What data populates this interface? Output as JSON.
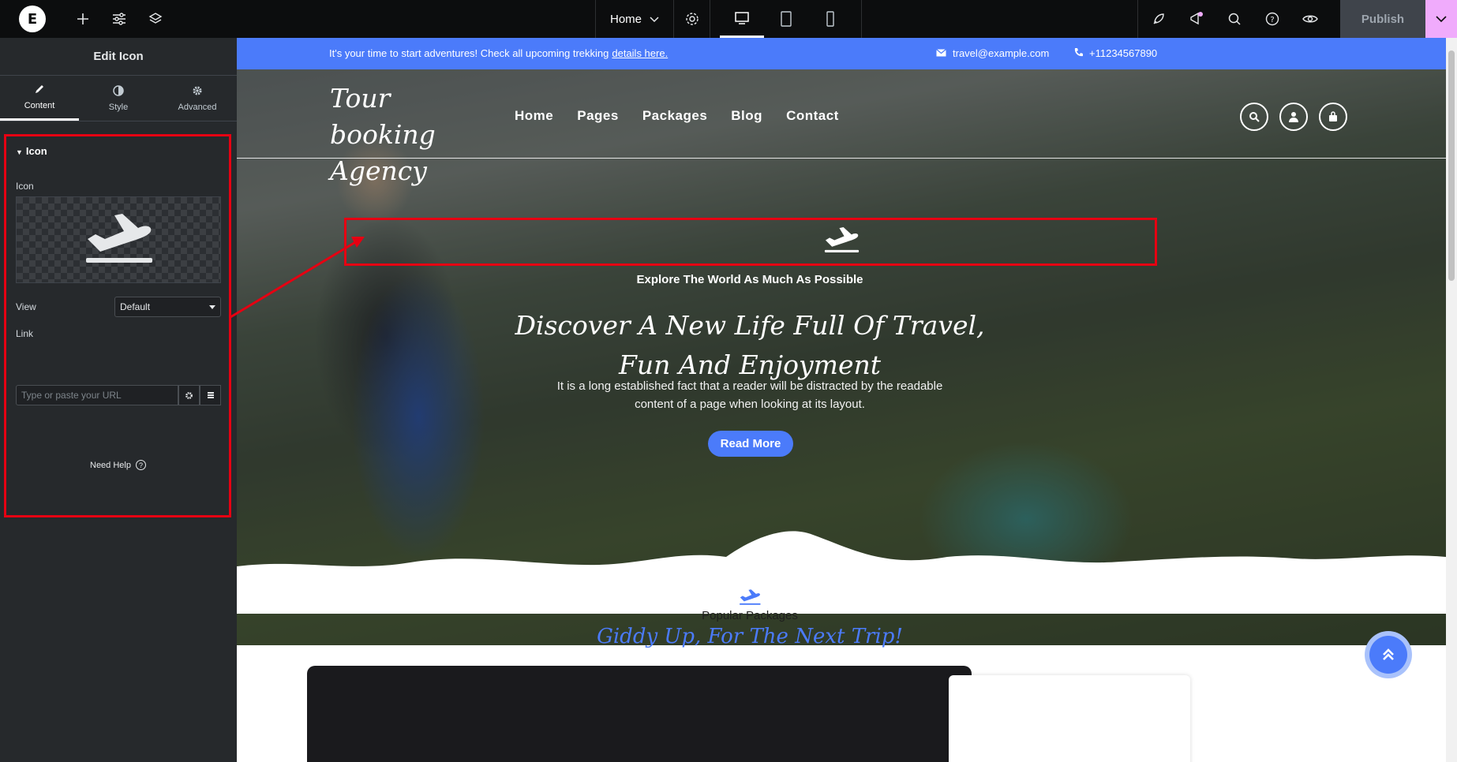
{
  "topbar": {
    "page_selector": "Home",
    "publish_label": "Publish"
  },
  "panel": {
    "title": "Edit Icon",
    "tabs": [
      {
        "label": "Content",
        "icon": "pencil-icon"
      },
      {
        "label": "Style",
        "icon": "half-circle-icon"
      },
      {
        "label": "Advanced",
        "icon": "gear-icon"
      }
    ],
    "section_title": "Icon",
    "icon_label": "Icon",
    "view_label": "View",
    "view_value": "Default",
    "link_label": "Link",
    "link_placeholder": "Type or paste your URL",
    "need_help": "Need Help"
  },
  "site": {
    "topstrip": {
      "message": "It's your time to start adventures! Check all upcoming trekking",
      "link": "details here.",
      "email": "travel@example.com",
      "phone": "+11234567890"
    },
    "brand": "Tour booking Agency",
    "nav": [
      "Home",
      "Pages",
      "Packages",
      "Blog",
      "Contact"
    ],
    "hero": {
      "eyebrow": "Explore The World As Much As Possible",
      "headline": "Discover A New Life Full Of Travel, Fun And Enjoyment",
      "description": "It is a long established fact that a reader will be distracted by the readable content of a page when looking at its layout.",
      "button": "Read More"
    },
    "packages": {
      "label": "Popular Packages",
      "title": "Giddy Up, For The Next Trip!"
    }
  },
  "colors": {
    "accent": "#4b7bfa",
    "highlight": "#e60012",
    "editor_dark": "#26292c",
    "publish_arrow": "#f0abfc"
  }
}
